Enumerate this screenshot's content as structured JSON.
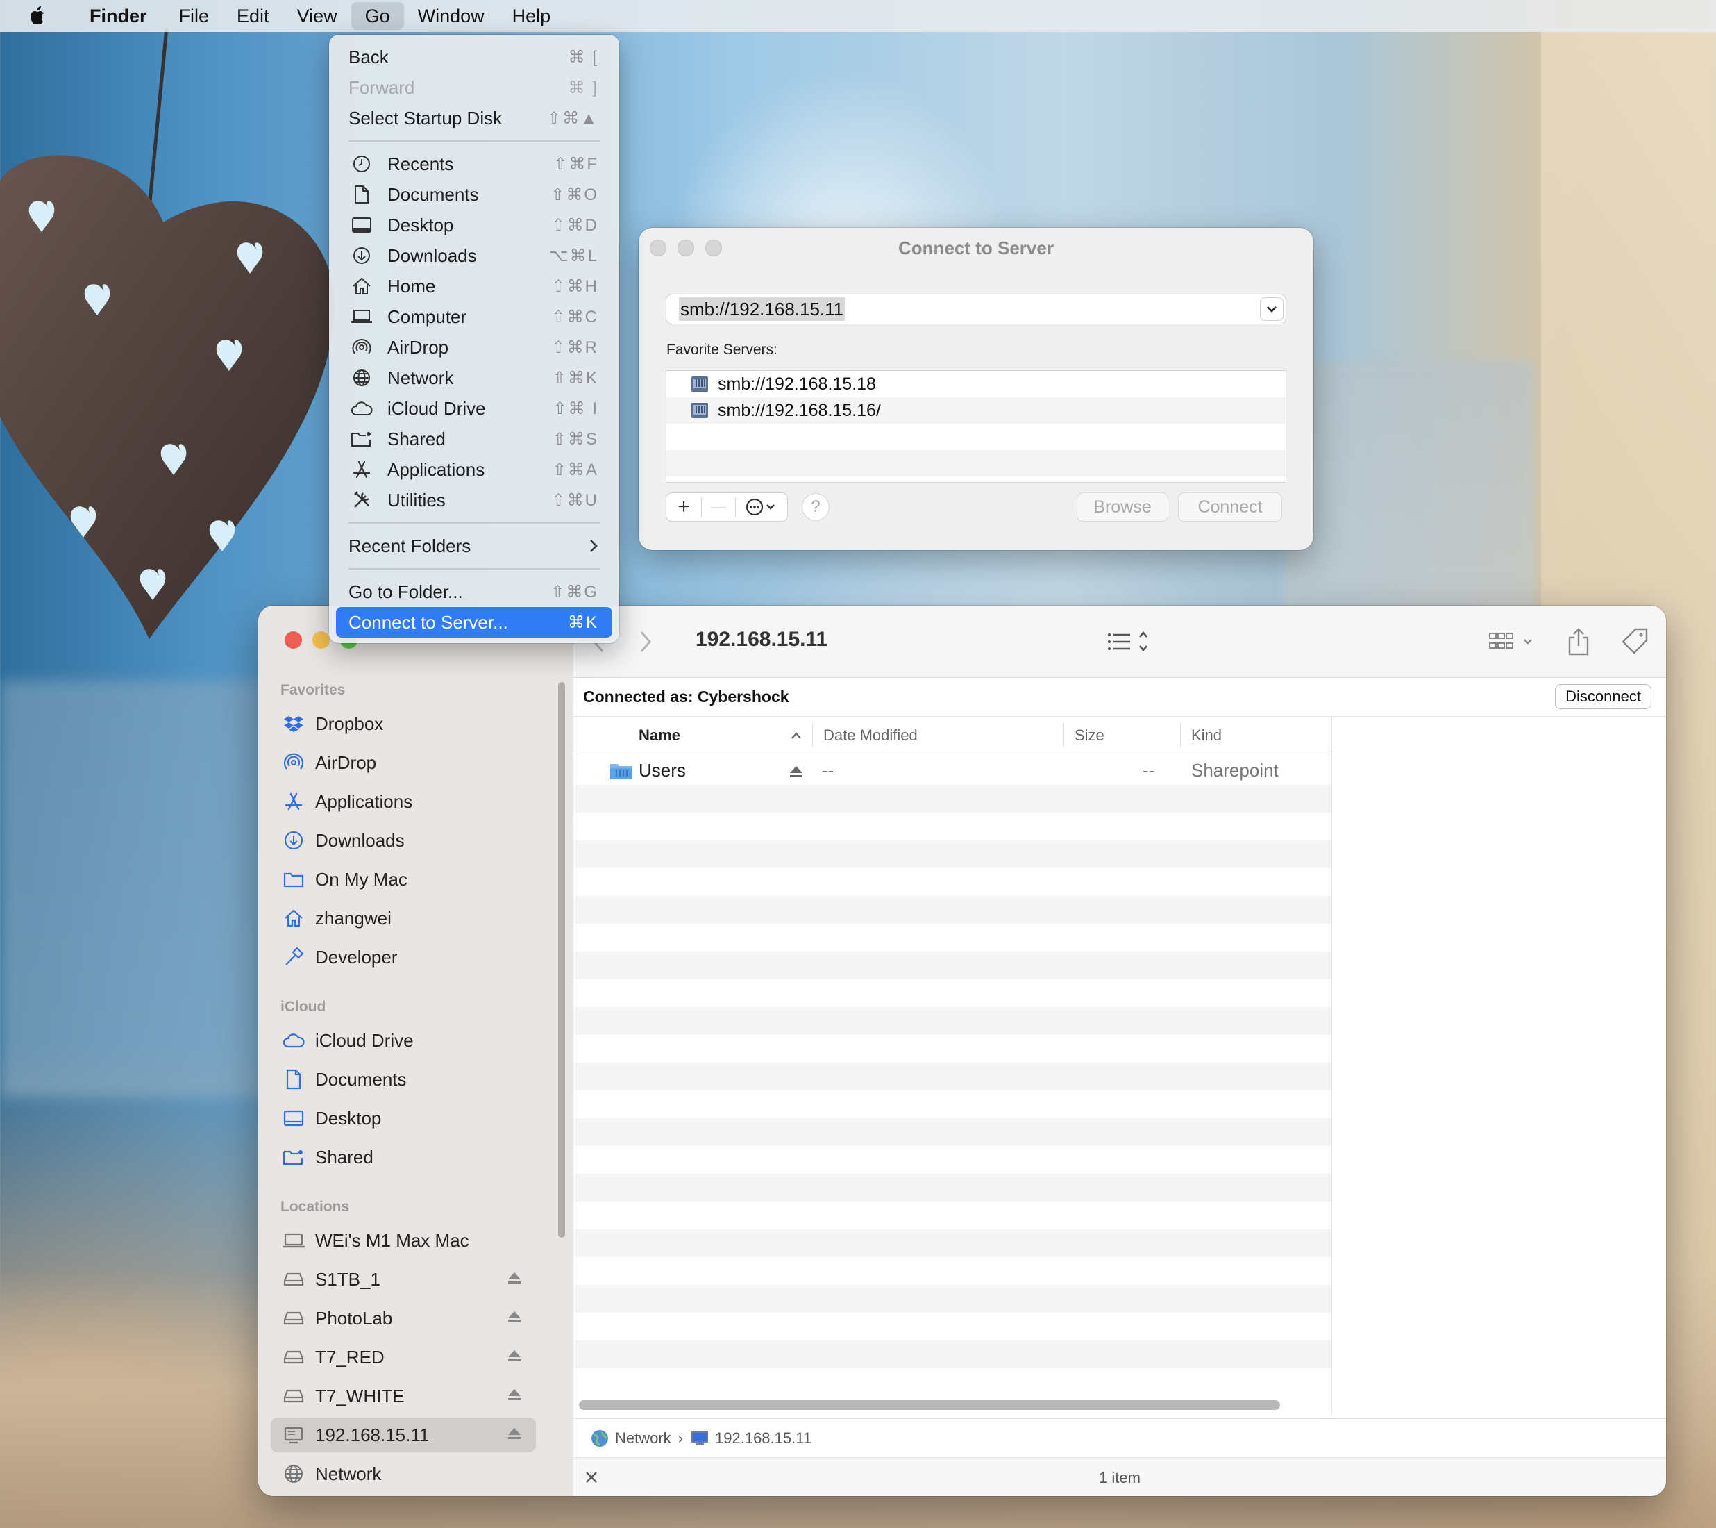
{
  "menubar": {
    "app": "Finder",
    "items": [
      "File",
      "Edit",
      "View",
      "Go",
      "Window",
      "Help"
    ]
  },
  "go_menu": {
    "back": {
      "label": "Back",
      "shortcut": "⌘ ["
    },
    "forward": {
      "label": "Forward",
      "shortcut": "⌘ ]"
    },
    "startup": {
      "label": "Select Startup Disk",
      "shortcut": "⇧⌘▲"
    },
    "places": [
      {
        "label": "Recents",
        "shortcut": "⇧⌘F",
        "icon": "clock-icon"
      },
      {
        "label": "Documents",
        "shortcut": "⇧⌘O",
        "icon": "document-icon"
      },
      {
        "label": "Desktop",
        "shortcut": "⇧⌘D",
        "icon": "desktop-icon"
      },
      {
        "label": "Downloads",
        "shortcut": "⌥⌘L",
        "icon": "download-icon"
      },
      {
        "label": "Home",
        "shortcut": "⇧⌘H",
        "icon": "home-icon"
      },
      {
        "label": "Computer",
        "shortcut": "⇧⌘C",
        "icon": "laptop-icon"
      },
      {
        "label": "AirDrop",
        "shortcut": "⇧⌘R",
        "icon": "airdrop-icon"
      },
      {
        "label": "Network",
        "shortcut": "⇧⌘K",
        "icon": "globe-icon"
      },
      {
        "label": "iCloud Drive",
        "shortcut": "⇧⌘ I",
        "icon": "cloud-icon"
      },
      {
        "label": "Shared",
        "shortcut": "⇧⌘S",
        "icon": "shared-folder-icon"
      },
      {
        "label": "Applications",
        "shortcut": "⇧⌘A",
        "icon": "applications-icon"
      },
      {
        "label": "Utilities",
        "shortcut": "⇧⌘U",
        "icon": "utilities-icon"
      }
    ],
    "recent_folders": "Recent Folders",
    "go_to_folder": {
      "label": "Go to Folder...",
      "shortcut": "⇧⌘G"
    },
    "connect_to_server": {
      "label": "Connect to Server...",
      "shortcut": "⌘K"
    }
  },
  "connect_dialog": {
    "title": "Connect to Server",
    "address": "smb://192.168.15.11",
    "favorites_label": "Favorite Servers:",
    "favorites": [
      "smb://192.168.15.18",
      "smb://192.168.15.16/"
    ],
    "add": "+",
    "remove": "—",
    "help": "?",
    "browse": "Browse",
    "connect": "Connect"
  },
  "finder": {
    "title": "192.168.15.11",
    "connected_as": "Connected as: Cybershock",
    "disconnect": "Disconnect",
    "sidebar": {
      "favorites_title": "Favorites",
      "favorites": [
        "Dropbox",
        "AirDrop",
        "Applications",
        "Downloads",
        "On My Mac",
        "zhangwei",
        "Developer"
      ],
      "icloud_title": "iCloud",
      "icloud": [
        "iCloud Drive",
        "Documents",
        "Desktop",
        "Shared"
      ],
      "locations_title": "Locations",
      "locations": [
        "WEi's M1 Max Mac",
        "S1TB_1",
        "PhotoLab",
        "T7_RED",
        "T7_WHITE",
        "192.168.15.11",
        "Network"
      ]
    },
    "columns": {
      "name": "Name",
      "date": "Date Modified",
      "size": "Size",
      "kind": "Kind"
    },
    "rows": [
      {
        "name": "Users",
        "date": "--",
        "size": "--",
        "kind": "Sharepoint"
      }
    ],
    "path": {
      "network": "Network",
      "server": "192.168.15.11",
      "sep": "›"
    },
    "status": "1 item"
  },
  "colors": {
    "accent": "#2f7cf6",
    "close": "#ed5e55",
    "minimize": "#f4bf4f",
    "zoom": "#61c554"
  }
}
